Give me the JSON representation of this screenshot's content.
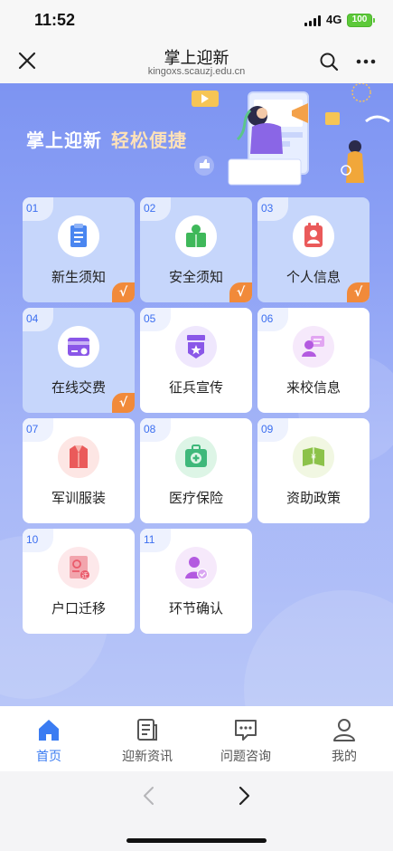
{
  "status": {
    "time": "11:52",
    "network": "4G",
    "battery": "100"
  },
  "navbar": {
    "title": "掌上迎新",
    "subtitle": "kingoxs.scauzj.edu.cn"
  },
  "banner": {
    "title_part1": "掌上迎新",
    "title_part2": "轻松便捷"
  },
  "cards": [
    {
      "num": "01",
      "label": "新生须知",
      "done": true,
      "icon": "notice-clipboard-icon",
      "color": "#4a86f0"
    },
    {
      "num": "02",
      "label": "安全须知",
      "done": true,
      "icon": "safety-book-icon",
      "color": "#3fb85a"
    },
    {
      "num": "03",
      "label": "个人信息",
      "done": true,
      "icon": "personal-info-icon",
      "color": "#ea5a5a"
    },
    {
      "num": "04",
      "label": "在线交费",
      "done": true,
      "icon": "online-payment-icon",
      "color": "#8a57e8"
    },
    {
      "num": "05",
      "label": "征兵宣传",
      "done": false,
      "icon": "recruitment-badge-icon",
      "color": "#8a57e8"
    },
    {
      "num": "06",
      "label": "来校信息",
      "done": false,
      "icon": "arrival-info-icon",
      "color": "#b35ae0"
    },
    {
      "num": "07",
      "label": "军训服装",
      "done": false,
      "icon": "uniform-icon",
      "color": "#ea5a5a"
    },
    {
      "num": "08",
      "label": "医疗保险",
      "done": false,
      "icon": "medical-kit-icon",
      "color": "#3fb87a"
    },
    {
      "num": "09",
      "label": "资助政策",
      "done": false,
      "icon": "funding-book-icon",
      "color": "#8cc24a"
    },
    {
      "num": "10",
      "label": "户口迁移",
      "done": false,
      "icon": "household-transfer-icon",
      "color": "#ea5a6a"
    },
    {
      "num": "11",
      "label": "环节确认",
      "done": false,
      "icon": "step-confirm-icon",
      "color": "#b35ae0"
    }
  ],
  "card_check_mark": "√",
  "tabs": [
    {
      "label": "首页",
      "icon": "home-icon",
      "active": true
    },
    {
      "label": "迎新资讯",
      "icon": "news-icon",
      "active": false
    },
    {
      "label": "问题咨询",
      "icon": "chat-icon",
      "active": false
    },
    {
      "label": "我的",
      "icon": "profile-icon",
      "active": false
    }
  ],
  "colors": {
    "accent": "#3b7cf2",
    "check_badge": "#f18a3a",
    "card_done_bg": "#c6d6fb",
    "bg_gradient_top": "#7d94f2"
  }
}
